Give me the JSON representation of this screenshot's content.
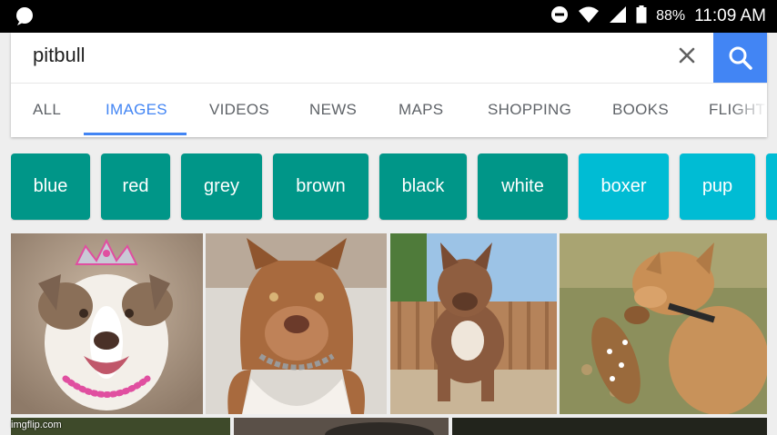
{
  "status_bar": {
    "battery": "88%",
    "time": "11:09 AM"
  },
  "search": {
    "query": "pitbull"
  },
  "tabs": [
    {
      "label": "ALL"
    },
    {
      "label": "IMAGES"
    },
    {
      "label": "VIDEOS"
    },
    {
      "label": "NEWS"
    },
    {
      "label": "MAPS"
    },
    {
      "label": "SHOPPING"
    },
    {
      "label": "BOOKS"
    },
    {
      "label": "FLIGHTS"
    }
  ],
  "active_tab": "IMAGES",
  "chips": [
    {
      "label": "blue",
      "color": "#009688"
    },
    {
      "label": "red",
      "color": "#009688"
    },
    {
      "label": "grey",
      "color": "#009688"
    },
    {
      "label": "brown",
      "color": "#009688"
    },
    {
      "label": "black",
      "color": "#009688"
    },
    {
      "label": "white",
      "color": "#009688"
    },
    {
      "label": "boxer",
      "color": "#00bcd4"
    },
    {
      "label": "pup",
      "color": "#00bcd4"
    }
  ],
  "watermark": "imgflip.com",
  "colors": {
    "accent": "#4285f4",
    "chip_teal": "#009688",
    "chip_cyan": "#00bcd4"
  }
}
